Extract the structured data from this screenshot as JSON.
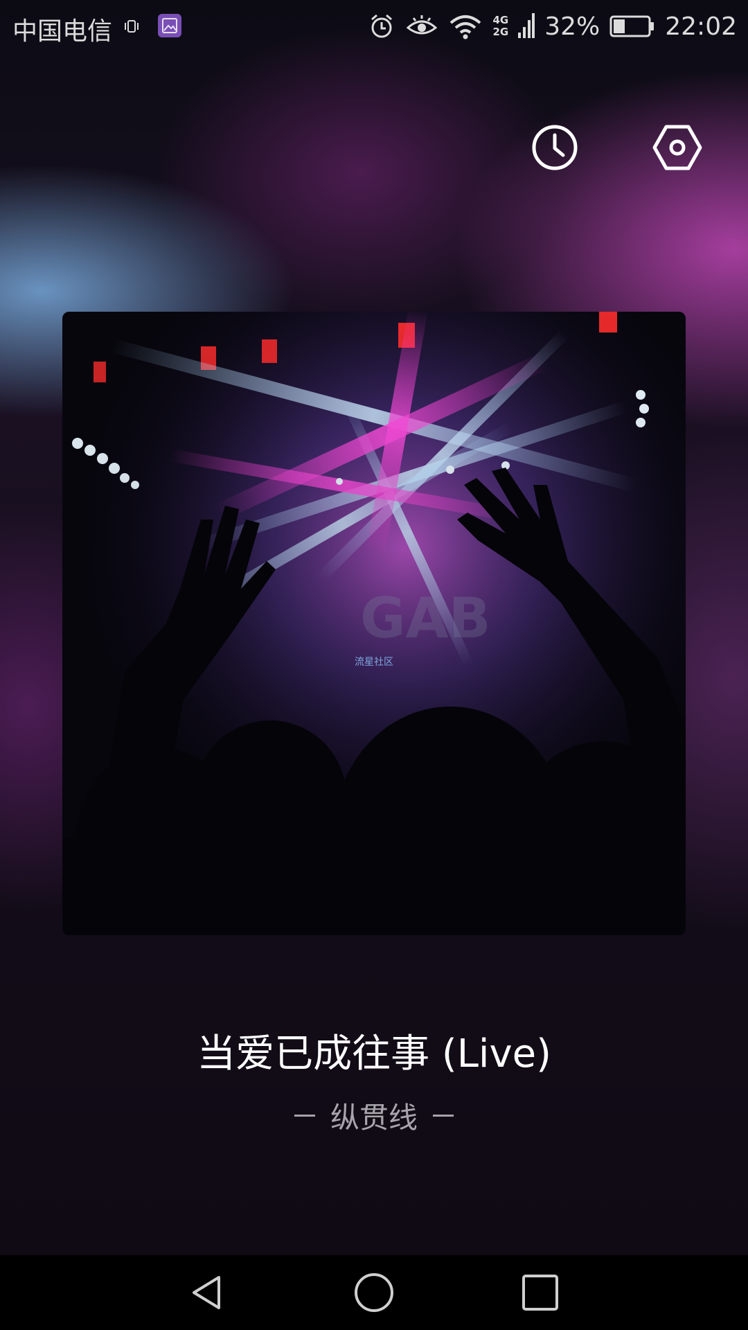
{
  "status_bar": {
    "carrier": "中国电信",
    "network_top": "4G",
    "network_bottom": "2G",
    "battery": "32%",
    "time": "22:02",
    "icons": [
      "vibrate-icon",
      "gallery-app-icon",
      "alarm-icon",
      "eye-comfort-icon",
      "wifi-icon",
      "signal-icon",
      "battery-icon"
    ]
  },
  "toolbar": {
    "history_icon": "clock-icon",
    "settings_icon": "hexagon-settings-icon"
  },
  "album": {
    "watermark": "流星社区"
  },
  "track": {
    "title": "当爱已成往事 (Live)",
    "artist": "纵贯线"
  },
  "nav_bar": {
    "icons": [
      "back-icon",
      "home-icon",
      "recents-icon"
    ]
  },
  "colors": {
    "accent_pink": "#c23fc0",
    "accent_blue": "#7aaedc",
    "title_text": "#ffffff",
    "artist_text": "#a7a4ab"
  }
}
